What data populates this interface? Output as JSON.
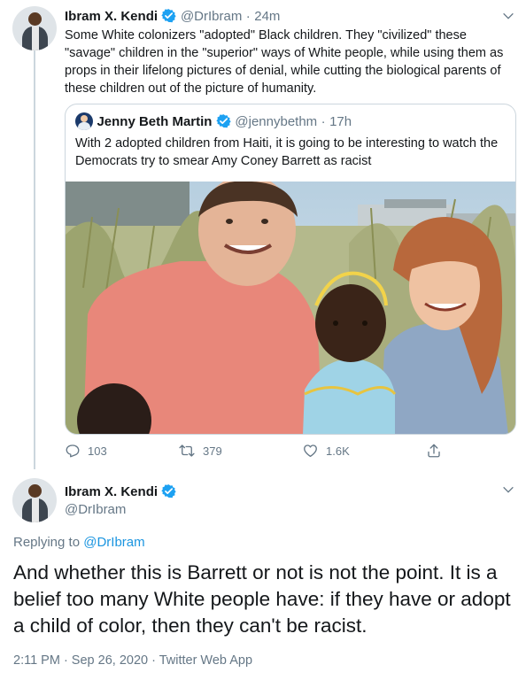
{
  "tweet1": {
    "author_name": "Ibram X. Kendi",
    "handle": "@DrIbram",
    "separator": "·",
    "time": "24m",
    "text": "Some White colonizers \"adopted\" Black children. They \"civilized\" these \"savage\" children in the \"superior\" ways of White people, while using them as props in their lifelong pictures of denial, while cutting the biological parents of these children out of the picture of humanity.",
    "quoted": {
      "author_name": "Jenny Beth Martin",
      "handle": "@jennybethm",
      "separator": "·",
      "time": "17h",
      "text": "With 2 adopted children from Haiti, it is going to be interesting to watch the Democrats try to smear Amy Coney Barrett as racist"
    },
    "actions": {
      "replies": "103",
      "retweets": "379",
      "likes": "1.6K"
    }
  },
  "tweet2": {
    "author_name": "Ibram X. Kendi",
    "handle": "@DrIbram",
    "replying_prefix": "Replying to ",
    "replying_handle": "@DrIbram",
    "text": "And whether this is Barrett or not is not the point. It is a belief too many White people have: if they have or adopt a child of color, then they can't be racist.",
    "timestamp": "2:11 PM · Sep 26, 2020 · Twitter Web App"
  },
  "colors": {
    "text": "#14171a",
    "secondary": "#657786",
    "link": "#1b95e0",
    "verified": "#1da1f2",
    "border": "#ccd6dd"
  },
  "icons": [
    "verified-badge-icon",
    "chevron-down-icon",
    "reply-icon",
    "retweet-icon",
    "like-icon",
    "share-icon"
  ]
}
